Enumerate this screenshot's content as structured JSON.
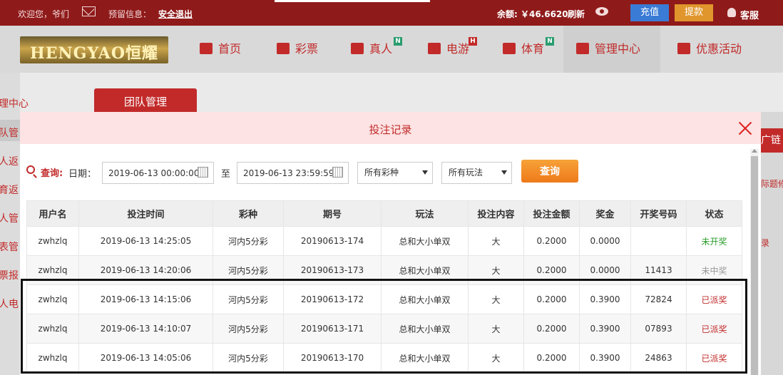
{
  "topbar": {
    "welcome": "欢迎您，爷们",
    "notice_label": "预留信息：",
    "logout": "安全退出",
    "balance": "余额: ￥46.6620",
    "refresh": "刷新",
    "recharge": "充值",
    "withdraw": "提款",
    "service": "客服"
  },
  "header": {
    "logo_text": "HENGYAO恒耀",
    "nav": [
      {
        "label": "首页",
        "icon": "home-icon"
      },
      {
        "label": "彩票",
        "icon": "ticket-icon"
      },
      {
        "label": "真人",
        "icon": "dealer-icon",
        "badge": "N"
      },
      {
        "label": "电游",
        "icon": "slot-icon",
        "badge": "H"
      },
      {
        "label": "体育",
        "icon": "trophy-icon",
        "badge": "N"
      },
      {
        "label": "管理中心",
        "icon": "users-icon"
      },
      {
        "label": "优惠活动",
        "icon": "gift-icon"
      }
    ]
  },
  "background": {
    "left_menu": [
      "理中心",
      "队管",
      "人返",
      "育返",
      "人管",
      "表管",
      "票报",
      "人电"
    ],
    "team_tab": "团队管理",
    "right_tab": "广链",
    "right_text_1": "际题修",
    "right_text_2": "录"
  },
  "modal": {
    "title": "投注记录",
    "filter": {
      "query_label": "查询:",
      "date_label": "日期：",
      "start_date": "2019-06-13 00:00:00",
      "to_label": "至",
      "end_date": "2019-06-13 23:59:59",
      "lottery_select": "所有彩种",
      "play_select": "所有玩法",
      "query_button": "查询"
    },
    "columns": [
      "用户名",
      "投注时间",
      "彩种",
      "期号",
      "玩法",
      "投注内容",
      "投注金额",
      "奖金",
      "开奖号码",
      "状态"
    ],
    "rows": [
      {
        "user": "zwhzlq",
        "time": "2019-06-13 14:25:05",
        "lottery": "河内5分彩",
        "issue": "20190613-174",
        "play": "总和大小单双",
        "content": "大",
        "amount": "0.2000",
        "prize": "0.0000",
        "number": "",
        "status": "未开奖",
        "status_type": "pending"
      },
      {
        "user": "zwhzlq",
        "time": "2019-06-13 14:20:06",
        "lottery": "河内5分彩",
        "issue": "20190613-173",
        "play": "总和大小单双",
        "content": "大",
        "amount": "0.2000",
        "prize": "0.0000",
        "number": "11413",
        "status": "未中奖",
        "status_type": "miss"
      },
      {
        "user": "zwhzlq",
        "time": "2019-06-13 14:15:06",
        "lottery": "河内5分彩",
        "issue": "20190613-172",
        "play": "总和大小单双",
        "content": "大",
        "amount": "0.2000",
        "prize": "0.3900",
        "number": "72824",
        "status": "已派奖",
        "status_type": "paid"
      },
      {
        "user": "zwhzlq",
        "time": "2019-06-13 14:10:07",
        "lottery": "河内5分彩",
        "issue": "20190613-171",
        "play": "总和大小单双",
        "content": "大",
        "amount": "0.2000",
        "prize": "0.3900",
        "number": "07893",
        "status": "已派奖",
        "status_type": "paid"
      },
      {
        "user": "zwhzlq",
        "time": "2019-06-13 14:05:06",
        "lottery": "河内5分彩",
        "issue": "20190613-170",
        "play": "总和大小单双",
        "content": "大",
        "amount": "0.2000",
        "prize": "0.3900",
        "number": "24863",
        "status": "已派奖",
        "status_type": "paid"
      }
    ]
  }
}
